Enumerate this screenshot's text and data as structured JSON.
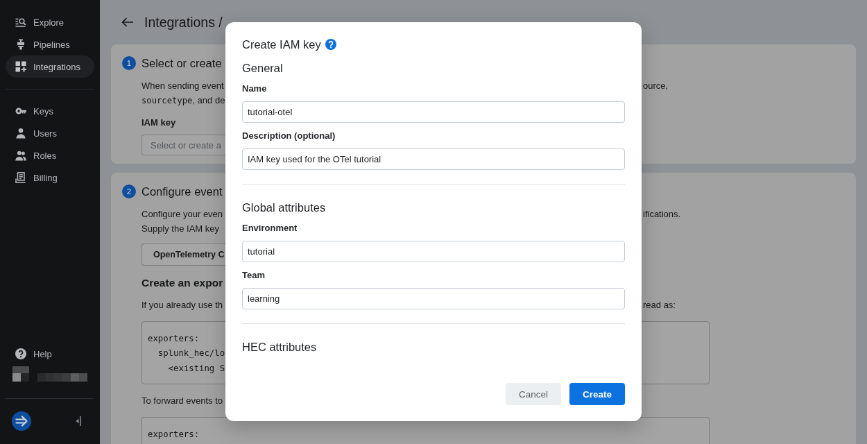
{
  "sidebar": {
    "primary_items": [
      {
        "label": "Explore",
        "selected": false
      },
      {
        "label": "Pipelines",
        "selected": false
      },
      {
        "label": "Integrations",
        "selected": true
      }
    ],
    "account_items": [
      {
        "label": "Keys",
        "selected": false
      },
      {
        "label": "Users",
        "selected": false
      },
      {
        "label": "Roles",
        "selected": false
      },
      {
        "label": "Billing",
        "selected": false
      }
    ],
    "help": {
      "label": "Help"
    }
  },
  "header": {
    "title": "Integrations /"
  },
  "steps": [
    {
      "number": "1",
      "heading": "Select or create",
      "blocks": [
        {
          "kind": "paragraph",
          "lines": [
            {
              "parts": [
                {
                  "kind": "text",
                  "text": "When sending event"
                }
              ],
              "right": "ource,"
            },
            {
              "parts": [
                {
                  "kind": "code",
                  "text": "sourcetype"
                },
                {
                  "kind": "text",
                  "text": ", and de"
                }
              ]
            }
          ]
        },
        {
          "kind": "field",
          "label": "IAM key",
          "placeholder": "Select or create a"
        }
      ]
    },
    {
      "number": "2",
      "heading": "Configure event",
      "blocks": [
        {
          "kind": "paragraph",
          "lines": [
            {
              "parts": [
                {
                  "kind": "text",
                  "text": "Configure your even"
                }
              ],
              "right": "ifications."
            },
            {
              "parts": [
                {
                  "kind": "text",
                  "text": "Supply the IAM key"
                }
              ]
            }
          ]
        },
        {
          "kind": "button",
          "label": "OpenTelemetry C"
        },
        {
          "kind": "subheading",
          "text": "Create an expor"
        },
        {
          "kind": "paragraph",
          "lines": [
            {
              "parts": [
                {
                  "kind": "text",
                  "text": "If you already use th"
                }
              ],
              "right": "read as:"
            }
          ]
        },
        {
          "kind": "code",
          "lines": [
            "exporters:",
            "  splunk_hec/lo",
            "    <existing S"
          ]
        },
        {
          "kind": "paragraph",
          "lines": [
            {
              "parts": [
                {
                  "kind": "text",
                  "text": "To forward events to"
                }
              ]
            }
          ]
        },
        {
          "kind": "code",
          "lines": [
            "exporters:"
          ]
        }
      ]
    }
  ],
  "dialog": {
    "title": "Create IAM key",
    "sections": [
      {
        "heading": "General",
        "fields": [
          {
            "label": "Name",
            "value": "tutorial-otel"
          },
          {
            "label": "Description (optional)",
            "value": "IAM key used for the OTel tutorial"
          }
        ]
      },
      {
        "heading": "Global attributes",
        "fields": [
          {
            "label": "Environment",
            "value": "tutorial"
          },
          {
            "label": "Team",
            "value": "learning"
          }
        ]
      },
      {
        "heading": "HEC attributes"
      }
    ],
    "buttons": [
      {
        "label": "Cancel",
        "kind": "secondary"
      },
      {
        "label": "Create",
        "kind": "primary"
      }
    ]
  }
}
